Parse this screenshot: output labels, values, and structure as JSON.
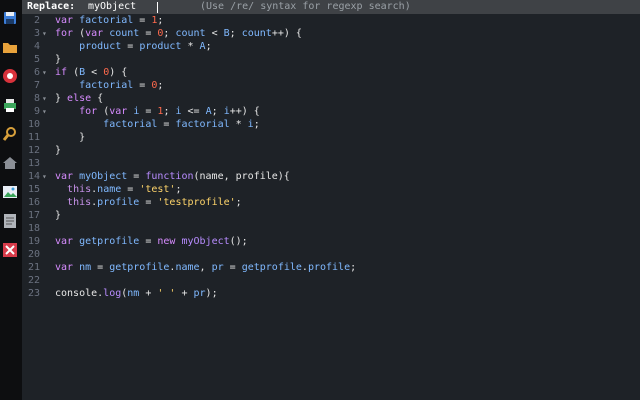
{
  "dock": {
    "icons": [
      {
        "name": "save-icon",
        "color": "#3b7dd8"
      },
      {
        "name": "folder-icon",
        "color": "#e8a23b"
      },
      {
        "name": "record-icon",
        "color": "#d8323b"
      },
      {
        "name": "printer-icon",
        "color": "#3aa55a"
      },
      {
        "name": "search-icon",
        "color": "#d8a03b"
      },
      {
        "name": "home-icon",
        "color": "#8b8f96"
      },
      {
        "name": "image-icon",
        "color": "#3a9ad8"
      },
      {
        "name": "document-icon",
        "color": "#b0b4ba"
      },
      {
        "name": "close-icon",
        "color": "#d83b4a"
      }
    ]
  },
  "replace_bar": {
    "label": "Replace:",
    "value": "myObject",
    "hint": "(Use /re/ syntax for regexp search)"
  },
  "editor": {
    "lines": [
      {
        "n": "2",
        "fold": "",
        "tokens": [
          [
            "kw",
            "var "
          ],
          [
            "id",
            "factorial"
          ],
          [
            "op",
            " = "
          ],
          [
            "num",
            "1"
          ],
          [
            "pn",
            ";"
          ]
        ]
      },
      {
        "n": "3",
        "fold": "▾",
        "tokens": [
          [
            "kw",
            "for "
          ],
          [
            "pn",
            "("
          ],
          [
            "kw",
            "var "
          ],
          [
            "id",
            "count"
          ],
          [
            "op",
            " = "
          ],
          [
            "num",
            "0"
          ],
          [
            "pn",
            "; "
          ],
          [
            "id",
            "count"
          ],
          [
            "op",
            " < "
          ],
          [
            "id",
            "B"
          ],
          [
            "pn",
            "; "
          ],
          [
            "id",
            "count"
          ],
          [
            "op",
            "++"
          ],
          [
            "pn",
            ") {"
          ]
        ]
      },
      {
        "n": "4",
        "fold": "",
        "tokens": [
          [
            "pn",
            "    "
          ],
          [
            "id",
            "product"
          ],
          [
            "op",
            " = "
          ],
          [
            "id",
            "product"
          ],
          [
            "op",
            " * "
          ],
          [
            "id",
            "A"
          ],
          [
            "pn",
            ";"
          ]
        ]
      },
      {
        "n": "5",
        "fold": "",
        "tokens": [
          [
            "pn",
            "}"
          ]
        ]
      },
      {
        "n": "6",
        "fold": "▾",
        "tokens": [
          [
            "kw",
            "if "
          ],
          [
            "pn",
            "("
          ],
          [
            "id",
            "B"
          ],
          [
            "op",
            " < "
          ],
          [
            "num",
            "0"
          ],
          [
            "pn",
            ") {"
          ]
        ]
      },
      {
        "n": "7",
        "fold": "",
        "tokens": [
          [
            "pn",
            "    "
          ],
          [
            "id",
            "factorial"
          ],
          [
            "op",
            " = "
          ],
          [
            "num",
            "0"
          ],
          [
            "pn",
            ";"
          ]
        ]
      },
      {
        "n": "8",
        "fold": "▾",
        "tokens": [
          [
            "pn",
            "} "
          ],
          [
            "kw",
            "else"
          ],
          [
            "pn",
            " {"
          ]
        ]
      },
      {
        "n": "9",
        "fold": "▾",
        "tokens": [
          [
            "pn",
            "    "
          ],
          [
            "kw",
            "for "
          ],
          [
            "pn",
            "("
          ],
          [
            "kw",
            "var "
          ],
          [
            "id",
            "i"
          ],
          [
            "op",
            " = "
          ],
          [
            "num",
            "1"
          ],
          [
            "pn",
            "; "
          ],
          [
            "id",
            "i"
          ],
          [
            "op",
            " <= "
          ],
          [
            "id",
            "A"
          ],
          [
            "pn",
            "; "
          ],
          [
            "id",
            "i"
          ],
          [
            "op",
            "++"
          ],
          [
            "pn",
            ") {"
          ]
        ]
      },
      {
        "n": "10",
        "fold": "",
        "tokens": [
          [
            "pn",
            "        "
          ],
          [
            "id",
            "factorial"
          ],
          [
            "op",
            " = "
          ],
          [
            "id",
            "factorial"
          ],
          [
            "op",
            " * "
          ],
          [
            "id",
            "i"
          ],
          [
            "pn",
            ";"
          ]
        ]
      },
      {
        "n": "11",
        "fold": "",
        "tokens": [
          [
            "pn",
            "    }"
          ]
        ]
      },
      {
        "n": "12",
        "fold": "",
        "tokens": [
          [
            "pn",
            "}"
          ]
        ]
      },
      {
        "n": "13",
        "fold": "",
        "tokens": []
      },
      {
        "n": "14",
        "fold": "▾",
        "tokens": [
          [
            "kw",
            "var "
          ],
          [
            "id",
            "myObject"
          ],
          [
            "op",
            " = "
          ],
          [
            "fn",
            "function"
          ],
          [
            "pn",
            "(name, profile){"
          ]
        ]
      },
      {
        "n": "15",
        "fold": "",
        "tokens": [
          [
            "pn",
            "  "
          ],
          [
            "th",
            "this"
          ],
          [
            "pn",
            "."
          ],
          [
            "id",
            "name"
          ],
          [
            "op",
            " = "
          ],
          [
            "str",
            "'test'"
          ],
          [
            "pn",
            ";"
          ]
        ]
      },
      {
        "n": "16",
        "fold": "",
        "tokens": [
          [
            "pn",
            "  "
          ],
          [
            "th",
            "this"
          ],
          [
            "pn",
            "."
          ],
          [
            "id",
            "profile"
          ],
          [
            "op",
            " = "
          ],
          [
            "str",
            "'testprofile'"
          ],
          [
            "pn",
            ";"
          ]
        ]
      },
      {
        "n": "17",
        "fold": "",
        "tokens": [
          [
            "pn",
            "}"
          ]
        ]
      },
      {
        "n": "18",
        "fold": "",
        "tokens": []
      },
      {
        "n": "19",
        "fold": "",
        "tokens": [
          [
            "kw",
            "var "
          ],
          [
            "id",
            "getprofile"
          ],
          [
            "op",
            " = "
          ],
          [
            "kw",
            "new "
          ],
          [
            "fn",
            "myObject"
          ],
          [
            "pn",
            "();"
          ]
        ]
      },
      {
        "n": "20",
        "fold": "",
        "tokens": []
      },
      {
        "n": "21",
        "fold": "",
        "tokens": [
          [
            "kw",
            "var "
          ],
          [
            "id",
            "nm"
          ],
          [
            "op",
            " = "
          ],
          [
            "id",
            "getprofile"
          ],
          [
            "pn",
            "."
          ],
          [
            "id",
            "name"
          ],
          [
            "pn",
            ", "
          ],
          [
            "id",
            "pr"
          ],
          [
            "op",
            " = "
          ],
          [
            "id",
            "getprofile"
          ],
          [
            "pn",
            "."
          ],
          [
            "id",
            "profile"
          ],
          [
            "pn",
            ";"
          ]
        ]
      },
      {
        "n": "22",
        "fold": "",
        "tokens": []
      },
      {
        "n": "23",
        "fold": "",
        "tokens": [
          [
            "pn",
            "console."
          ],
          [
            "fn",
            "log"
          ],
          [
            "pn",
            "("
          ],
          [
            "id",
            "nm"
          ],
          [
            "op",
            " + "
          ],
          [
            "str",
            "' '"
          ],
          [
            "op",
            " + "
          ],
          [
            "id",
            "pr"
          ],
          [
            "pn",
            ");"
          ]
        ]
      }
    ]
  }
}
